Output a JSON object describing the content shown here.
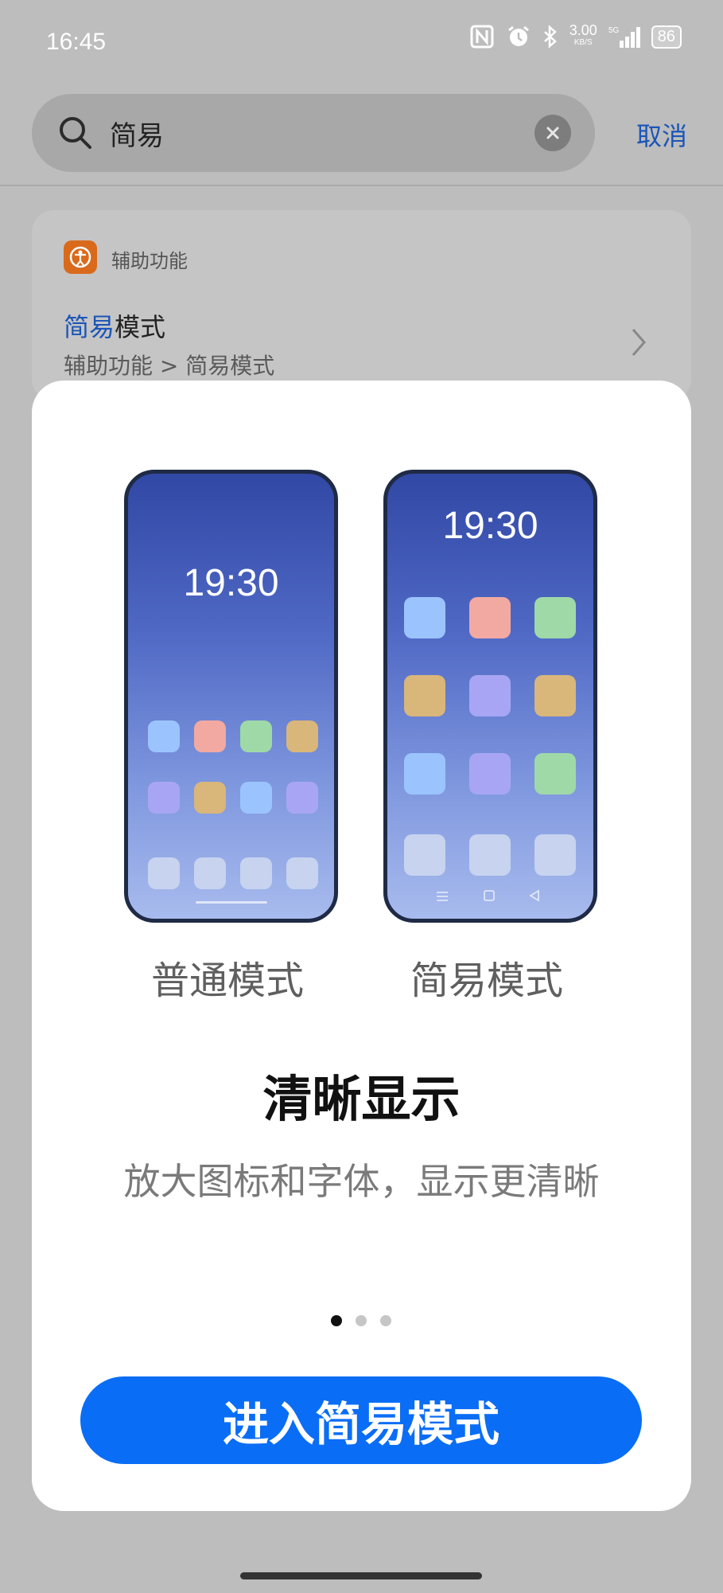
{
  "status_bar": {
    "time": "16:45",
    "net_speed": "3.00",
    "net_unit": "KB/S",
    "battery": "86",
    "icons": [
      "nfc-icon",
      "alarm-icon",
      "bluetooth-icon",
      "signal-icon",
      "battery-icon"
    ]
  },
  "search": {
    "query": "简易",
    "cancel_label": "取消"
  },
  "result": {
    "category": "辅助功能",
    "title_highlight": "简易",
    "title_rest": "模式",
    "path": "辅助功能 > 简易模式"
  },
  "sheet": {
    "normal_mode": {
      "time": "19:30",
      "label": "普通模式"
    },
    "simple_mode": {
      "time": "19:30",
      "label": "简易模式"
    },
    "headline": "清晰显示",
    "description": "放大图标和字体，显示更清晰",
    "page_indicator": {
      "current": 1,
      "total": 3
    },
    "enter_button": "进入简易模式"
  },
  "colors": {
    "accent_blue": "#0a6df5",
    "link_blue": "#1a55b8",
    "tile_blue": "#9bc4ff",
    "tile_red": "#f1a9a2",
    "tile_green": "#9fd9a7",
    "tile_yellow": "#d9b67a",
    "tile_purple": "#a8a6f4",
    "tile_gray": "#c7d3ef"
  }
}
